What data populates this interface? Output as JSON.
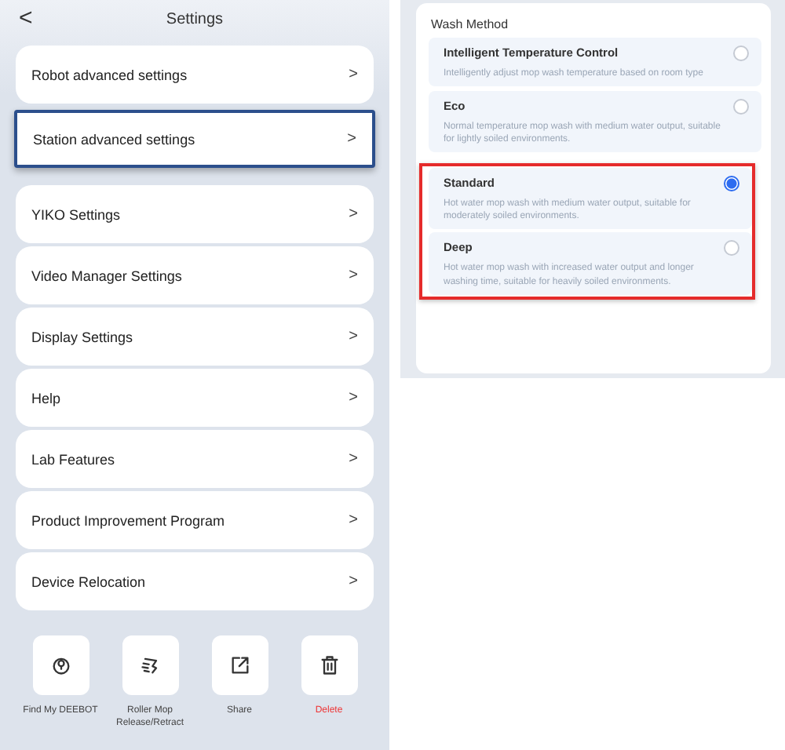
{
  "settings": {
    "back": "<",
    "title": "Settings",
    "items": [
      {
        "label": "Robot advanced settings",
        "chevron": ">",
        "highlighted": false
      },
      {
        "label": "Station advanced settings",
        "chevron": ">",
        "highlighted": true
      },
      {
        "label": "YIKO Settings",
        "chevron": ">",
        "highlighted": false
      },
      {
        "label": "Video Manager Settings",
        "chevron": ">",
        "highlighted": false
      },
      {
        "label": "Display Settings",
        "chevron": ">",
        "highlighted": false
      },
      {
        "label": "Help",
        "chevron": ">",
        "highlighted": false
      },
      {
        "label": "Lab Features",
        "chevron": ">",
        "highlighted": false
      },
      {
        "label": "Product Improvement Program",
        "chevron": ">",
        "highlighted": false
      },
      {
        "label": "Device Relocation",
        "chevron": ">",
        "highlighted": false
      }
    ],
    "actions": [
      {
        "kind": "locate",
        "label": "Find My DEEBOT",
        "danger": false
      },
      {
        "kind": "mop",
        "label": "Roller Mop Release/Retract",
        "danger": false
      },
      {
        "kind": "share",
        "label": "Share",
        "danger": false
      },
      {
        "kind": "delete",
        "label": "Delete",
        "danger": true
      }
    ]
  },
  "wash_method": {
    "title": "Wash Method",
    "options": [
      {
        "name": "Intelligent Temperature Control",
        "description": "Intelligently adjust mop wash temperature based on room type",
        "selected": false,
        "annotated": false
      },
      {
        "name": "Eco",
        "description": "Normal temperature mop wash with medium water output, suitable for lightly soiled environments.",
        "selected": false,
        "annotated": false
      },
      {
        "name": "Standard",
        "description": "Hot water mop wash with medium water output, suitable for moderately soiled environments.",
        "selected": true,
        "annotated": true
      },
      {
        "name": "Deep",
        "description": "Hot water mop wash with increased water output and longer washing time, suitable for heavily soiled environments.",
        "selected": false,
        "annotated": true
      }
    ]
  }
}
